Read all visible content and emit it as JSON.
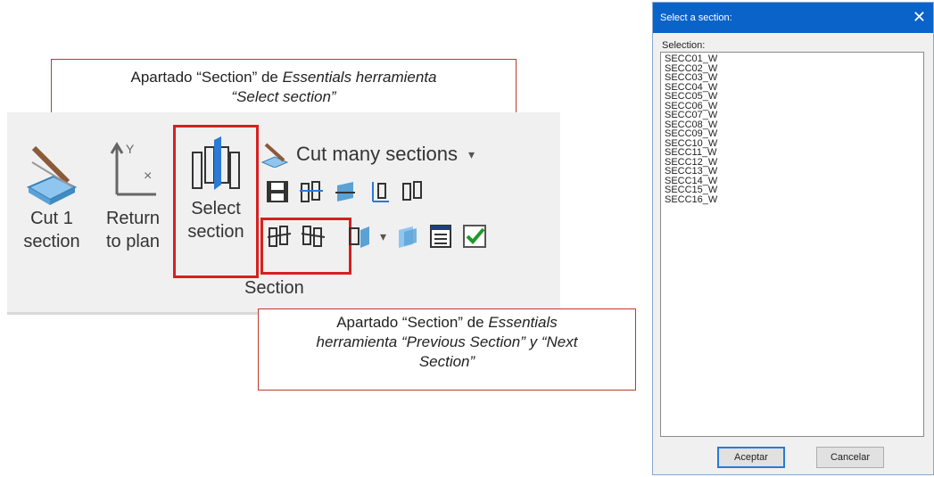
{
  "callouts": {
    "top": {
      "line1_plain": "Apartado “Section” de ",
      "line1_italic": "Essentials herramienta",
      "line2_italic": "“Select section”"
    },
    "bottom": {
      "line1_plain": "Apartado “Section” de ",
      "line1_italic": "Essentials",
      "line2_italic": "herramienta “Previous Section” y “Next",
      "line3_italic": "Section”"
    }
  },
  "ribbon": {
    "cut1": {
      "line1": "Cut 1",
      "line2": "section"
    },
    "return": {
      "line1": "Return",
      "line2": "to plan"
    },
    "select": {
      "line1": "Select",
      "line2": "section"
    },
    "cut_many": "Cut many  sections",
    "group_label": "Section"
  },
  "dialog": {
    "title": "Select a section:",
    "selection_label": "Selection:",
    "items": [
      "SECC01_W",
      "SECC02_W",
      "SECC03_W",
      "SECC04_W",
      "SECC05_W",
      "SECC06_W",
      "SECC07_W",
      "SECC08_W",
      "SECC09_W",
      "SECC10_W",
      "SECC11_W",
      "SECC12_W",
      "SECC13_W",
      "SECC14_W",
      "SECC15_W",
      "SECC16_W"
    ],
    "ok_label": "Aceptar",
    "cancel_label": "Cancelar"
  },
  "colors": {
    "accent_red": "#d62020",
    "title_blue": "#0a63c9"
  }
}
